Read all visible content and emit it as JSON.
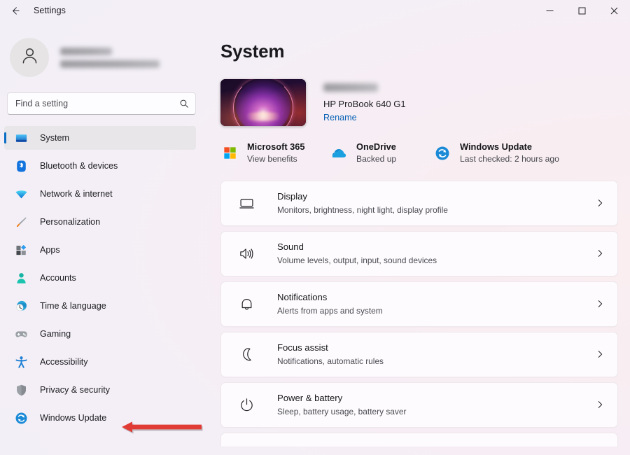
{
  "window": {
    "app_title": "Settings",
    "back_icon": "back-arrow-icon",
    "controls": {
      "minimize": "minimize-icon",
      "maximize": "maximize-icon",
      "close": "close-icon"
    }
  },
  "sidebar": {
    "account": {
      "avatar_icon": "person-avatar-icon",
      "name": "",
      "email": "",
      "redacted": true
    },
    "search": {
      "placeholder": "Find a setting",
      "value": "",
      "icon": "search-icon"
    },
    "items": [
      {
        "label": "System",
        "icon": "monitor-icon",
        "selected": true
      },
      {
        "label": "Bluetooth & devices",
        "icon": "bluetooth-icon",
        "selected": false
      },
      {
        "label": "Network & internet",
        "icon": "wifi-icon",
        "selected": false
      },
      {
        "label": "Personalization",
        "icon": "paintbrush-icon",
        "selected": false
      },
      {
        "label": "Apps",
        "icon": "apps-grid-icon",
        "selected": false
      },
      {
        "label": "Accounts",
        "icon": "person-icon",
        "selected": false
      },
      {
        "label": "Time & language",
        "icon": "clock-globe-icon",
        "selected": false
      },
      {
        "label": "Gaming",
        "icon": "gamepad-icon",
        "selected": false
      },
      {
        "label": "Accessibility",
        "icon": "accessibility-icon",
        "selected": false
      },
      {
        "label": "Privacy & security",
        "icon": "shield-icon",
        "selected": false
      },
      {
        "label": "Windows Update",
        "icon": "update-sync-icon",
        "selected": false
      }
    ]
  },
  "main": {
    "title": "System",
    "device": {
      "thumbnail_icon": "windows-bloom-wallpaper",
      "pc_name": "",
      "pc_name_redacted": true,
      "model": "HP ProBook 640 G1",
      "rename_label": "Rename"
    },
    "tiles": [
      {
        "title": "Microsoft 365",
        "subtitle": "View benefits",
        "icon": "microsoft-logo-icon"
      },
      {
        "title": "OneDrive",
        "subtitle": "Backed up",
        "icon": "onedrive-cloud-icon"
      },
      {
        "title": "Windows Update",
        "subtitle": "Last checked: 2 hours ago",
        "icon": "update-sync-icon"
      }
    ],
    "rows": [
      {
        "title": "Display",
        "subtitle": "Monitors, brightness, night light, display profile",
        "icon": "monitor-outline-icon",
        "chevron": "chevron-right-icon"
      },
      {
        "title": "Sound",
        "subtitle": "Volume levels, output, input, sound devices",
        "icon": "speaker-icon",
        "chevron": "chevron-right-icon"
      },
      {
        "title": "Notifications",
        "subtitle": "Alerts from apps and system",
        "icon": "bell-icon",
        "chevron": "chevron-right-icon"
      },
      {
        "title": "Focus assist",
        "subtitle": "Notifications, automatic rules",
        "icon": "moon-icon",
        "chevron": "chevron-right-icon"
      },
      {
        "title": "Power & battery",
        "subtitle": "Sleep, battery usage, battery saver",
        "icon": "power-icon",
        "chevron": "chevron-right-icon"
      }
    ]
  },
  "annotation": {
    "arrow": {
      "icon": "red-arrow-left-icon",
      "points_to": "Windows Update",
      "color": "#e03b35"
    }
  },
  "colors": {
    "accent": "#0b6ec4",
    "link": "#0a60b6",
    "selected_bg": "#e8e6e9",
    "card_bg": "#fdfbfd",
    "page_bg": "#f6eef3",
    "annotation_red": "#e03b35"
  }
}
